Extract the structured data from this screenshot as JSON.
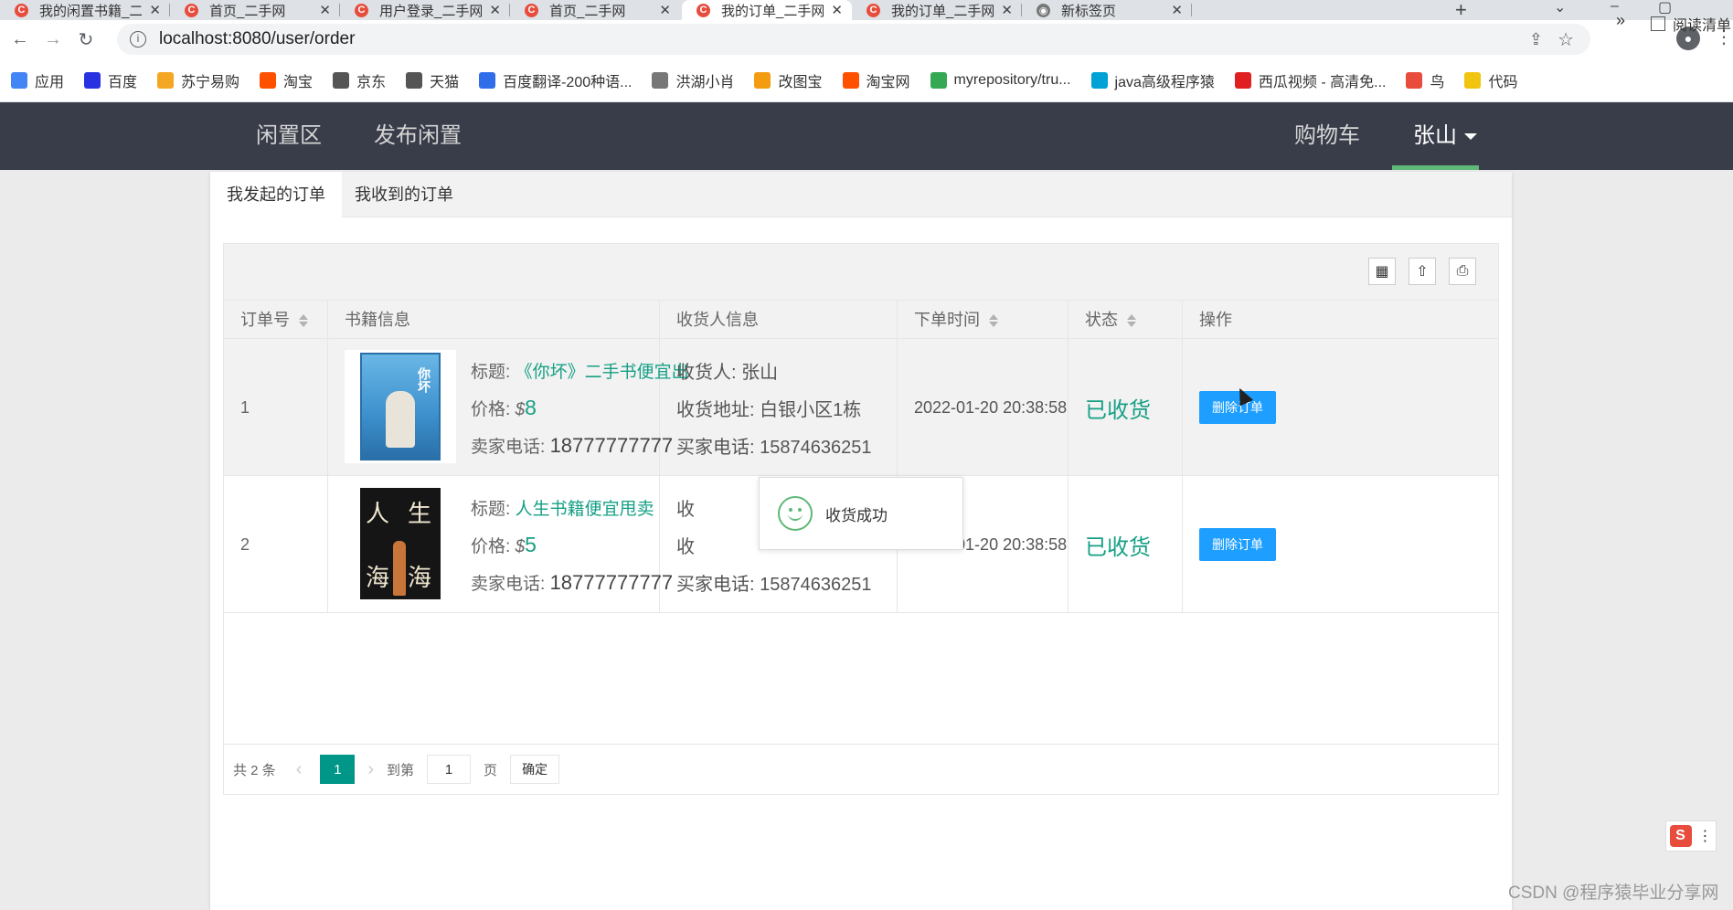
{
  "browser": {
    "tabs": [
      {
        "title": "我的闲置书籍_二手网",
        "icon": "csdn-icon"
      },
      {
        "title": "首页_二手网",
        "icon": "csdn-icon"
      },
      {
        "title": "用户登录_二手网",
        "icon": "csdn-icon"
      },
      {
        "title": "首页_二手网",
        "icon": "csdn-icon"
      },
      {
        "title": "我的订单_二手网",
        "icon": "csdn-icon",
        "active": true
      },
      {
        "title": "我的订单_二手网",
        "icon": "csdn-icon"
      },
      {
        "title": "新标签页",
        "icon": "chrome-icon"
      }
    ],
    "url": "localhost:8080/user/order",
    "bookmarks": [
      {
        "label": "应用",
        "color": "#4285f4"
      },
      {
        "label": "百度",
        "color": "#2932e1"
      },
      {
        "label": "苏宁易购",
        "color": "#f5a623"
      },
      {
        "label": "淘宝",
        "color": "#ff5000"
      },
      {
        "label": "京东",
        "color": "#555555"
      },
      {
        "label": "天猫",
        "color": "#555555"
      },
      {
        "label": "百度翻译-200种语...",
        "color": "#2f6ee8"
      },
      {
        "label": "洪湖小肖",
        "color": "#777777"
      },
      {
        "label": "改图宝",
        "color": "#f39c12"
      },
      {
        "label": "淘宝网",
        "color": "#ff5000"
      },
      {
        "label": "myrepository/tru...",
        "color": "#34a853"
      },
      {
        "label": "java高级程序猿",
        "color": "#00a1d6"
      },
      {
        "label": "西瓜视频 - 高清免...",
        "color": "#e02020"
      },
      {
        "label": "鸟",
        "color": "#e74c3c"
      },
      {
        "label": "代码",
        "color": "#f1c40f"
      }
    ],
    "more": "»",
    "reading_list": "阅读清单"
  },
  "nav": {
    "items": [
      "闲置区",
      "发布闲置"
    ],
    "cart": "购物车",
    "user": "张山"
  },
  "panel": {
    "tabs": [
      "我发起的订单",
      "我收到的订单"
    ]
  },
  "table": {
    "headers": [
      "订单号",
      "书籍信息",
      "收货人信息",
      "下单时间",
      "状态",
      "操作"
    ],
    "rows": [
      {
        "id": "1",
        "title_label": "标题:",
        "title": "《你坏》二手书便宜出",
        "price_label": "价格:",
        "currency": "$",
        "price": "8",
        "seller_label": "卖家电话:",
        "seller_phone": "18777777777",
        "receiver": "收货人: 张山",
        "address": "收货地址: 白银小区1栋",
        "buyer_phone": "买家电话: 15874636251",
        "time": "2022-01-20 20:38:58",
        "status": "已收货",
        "action": "删除订单"
      },
      {
        "id": "2",
        "title_label": "标题:",
        "title": "人生书籍便宜甩卖",
        "price_label": "价格:",
        "currency": "$",
        "price": "5",
        "seller_label": "卖家电话:",
        "seller_phone": "18777777777",
        "receiver": "收",
        "address": "收",
        "buyer_phone": "买家电话: 15874636251",
        "time": "2022-01-20 20:38:58",
        "status": "已收货",
        "action": "删除订单"
      }
    ],
    "covers": [
      {
        "text": "你坏"
      },
      {
        "text_a": "人",
        "text_b": "生",
        "text_c": "海",
        "text_d": "海"
      }
    ]
  },
  "toast": {
    "message": "收货成功"
  },
  "pager": {
    "total": "共 2 条",
    "current": "1",
    "goto_label": "到第",
    "page_value": "1",
    "page_unit": "页",
    "confirm": "确定"
  },
  "watermark": "CSDN @程序猿毕业分享网",
  "colors": {
    "nav_bg": "#393d49",
    "accent": "#16a085",
    "button": "#1e9fff",
    "pager_current": "#009688"
  }
}
